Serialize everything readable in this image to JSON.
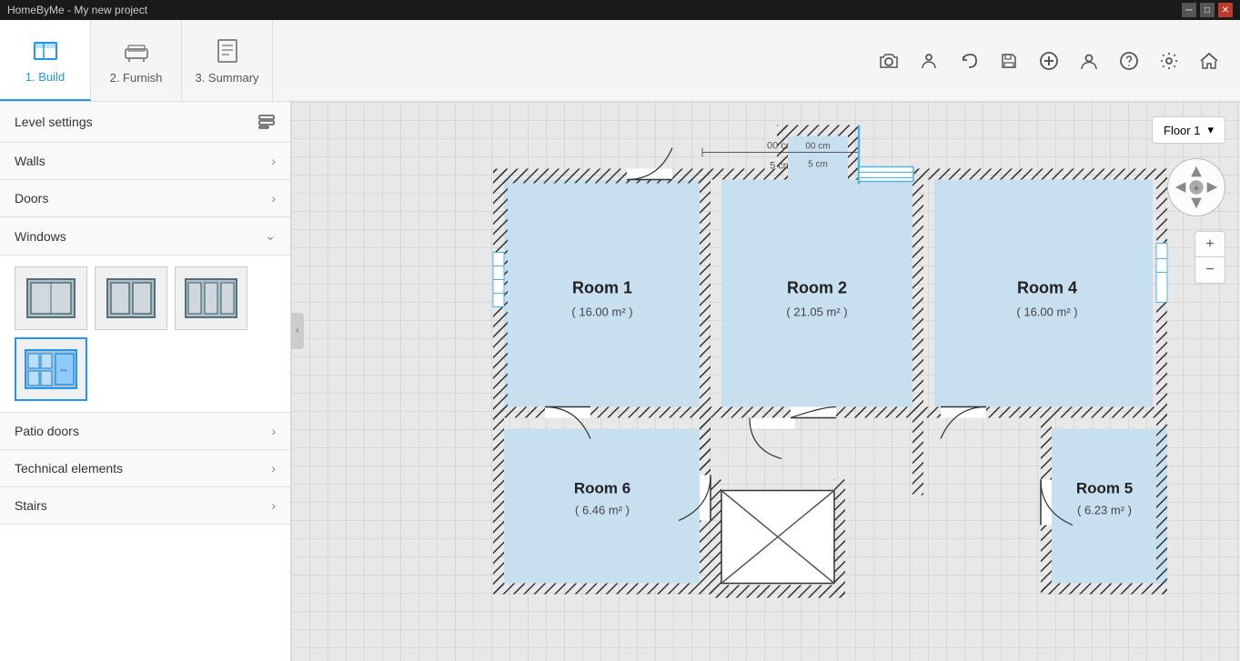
{
  "titlebar": {
    "title": "HomeByMe - My new project",
    "min_label": "─",
    "max_label": "□",
    "close_label": "✕"
  },
  "toolbar": {
    "tabs": [
      {
        "id": "build",
        "label": "1. Build",
        "active": true
      },
      {
        "id": "furnish",
        "label": "2. Furnish",
        "active": false
      },
      {
        "id": "summary",
        "label": "3. Summary",
        "active": false
      }
    ],
    "icons": [
      {
        "id": "camera",
        "symbol": "📷"
      },
      {
        "id": "person",
        "symbol": "👤"
      },
      {
        "id": "undo",
        "symbol": "↩"
      },
      {
        "id": "save",
        "symbol": "💾"
      },
      {
        "id": "add",
        "symbol": "+"
      },
      {
        "id": "account",
        "symbol": "👤"
      },
      {
        "id": "help",
        "symbol": "?"
      },
      {
        "id": "settings",
        "symbol": "⚙"
      },
      {
        "id": "home",
        "symbol": "🏠"
      }
    ]
  },
  "sidebar": {
    "level_settings": {
      "label": "Level settings"
    },
    "sections": [
      {
        "id": "walls",
        "label": "Walls",
        "expanded": false
      },
      {
        "id": "doors",
        "label": "Doors",
        "expanded": false
      },
      {
        "id": "windows",
        "label": "Windows",
        "expanded": true
      },
      {
        "id": "patio_doors",
        "label": "Patio doors",
        "expanded": false
      },
      {
        "id": "technical",
        "label": "Technical elements",
        "expanded": false
      },
      {
        "id": "stairs",
        "label": "Stairs",
        "expanded": false
      }
    ],
    "windows": {
      "items": [
        {
          "id": "w1",
          "label": "Single window",
          "selected": false
        },
        {
          "id": "w2",
          "label": "Double window",
          "selected": false
        },
        {
          "id": "w3",
          "label": "Triple window",
          "selected": false
        },
        {
          "id": "w4",
          "label": "Bay window",
          "selected": true
        }
      ]
    }
  },
  "canvas": {
    "floor_selector": {
      "label": "Floor 1",
      "chevron": "▾"
    },
    "zoom_plus": "+",
    "zoom_minus": "−",
    "rooms": [
      {
        "id": "room1",
        "label": "Room 1",
        "area": "( 16.00 m² )"
      },
      {
        "id": "room2",
        "label": "Room 2",
        "area": "( 21.05 m² )"
      },
      {
        "id": "room4",
        "label": "Room 4",
        "area": "( 16.00 m² )"
      },
      {
        "id": "room5",
        "label": "Room 5",
        "area": "( 6.23 m² )"
      },
      {
        "id": "room6",
        "label": "Room 6",
        "area": "( 6.46 m² )"
      }
    ],
    "measurements": {
      "top_label": "00 cm",
      "mid_label": "5 cm"
    }
  }
}
